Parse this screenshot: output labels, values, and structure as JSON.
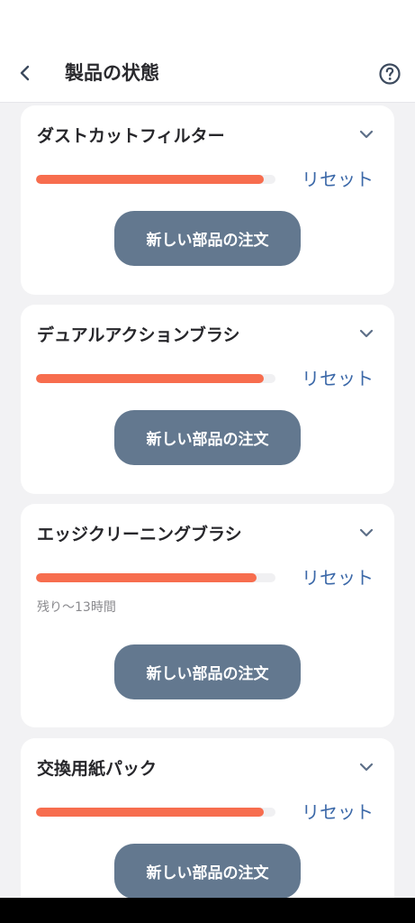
{
  "header": {
    "title": "製品の状態",
    "back_icon": "chevron-left-icon",
    "help_icon": "help-circle-icon"
  },
  "colors": {
    "accent": "#3b68a8",
    "progress": "#f76d4e",
    "button": "#63788f"
  },
  "parts": [
    {
      "name": "ダストカットフィルター",
      "remaining_fraction": 0.95,
      "reset_label": "リセット",
      "remaining_text": "",
      "order_label": "新しい部品の注文"
    },
    {
      "name": "デュアルアクションブラシ",
      "remaining_fraction": 0.95,
      "reset_label": "リセット",
      "remaining_text": "",
      "order_label": "新しい部品の注文"
    },
    {
      "name": "エッジクリーニングブラシ",
      "remaining_fraction": 0.92,
      "reset_label": "リセット",
      "remaining_text": "残り～13時間",
      "order_label": "新しい部品の注文"
    },
    {
      "name": "交換用紙パック",
      "remaining_fraction": 0.95,
      "reset_label": "リセット",
      "remaining_text": "",
      "order_label": "新しい部品の注文"
    }
  ]
}
